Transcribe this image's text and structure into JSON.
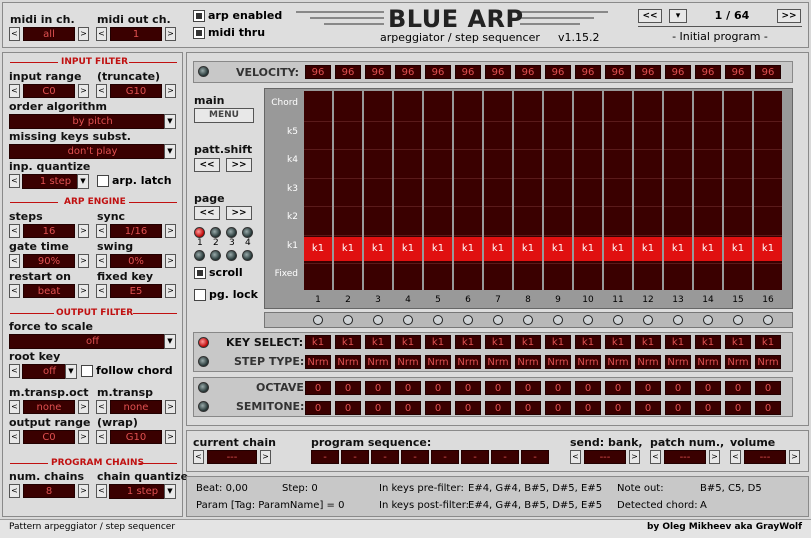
{
  "midi": {
    "in_label": "midi in ch.",
    "in_value": "all",
    "out_label": "midi out ch.",
    "out_value": "1"
  },
  "toggles": {
    "arp_enabled": "arp enabled",
    "midi_thru": "midi thru"
  },
  "title": {
    "name": "BLUE ARP",
    "subtitle": "arpeggiator / step sequencer",
    "version": "v1.15.2"
  },
  "program": {
    "counter": "1 / 64",
    "name": "- Initial program -"
  },
  "input_filter": {
    "header": "INPUT FILTER",
    "range_label": "input range",
    "truncate_label": "(truncate)",
    "range_low": "C0",
    "range_high": "G10",
    "order_label": "order algorithm",
    "order_value": "by pitch",
    "missing_label": "missing keys subst.",
    "missing_value": "don't play",
    "quantize_label": "inp. quantize",
    "quantize_value": "1 step",
    "latch_label": "arp. latch"
  },
  "arp_engine": {
    "header": "ARP ENGINE",
    "steps_label": "steps",
    "steps_value": "16",
    "sync_label": "sync",
    "sync_value": "1/16",
    "gate_label": "gate time",
    "gate_value": "90%",
    "swing_label": "swing",
    "swing_value": "0%",
    "restart_label": "restart on",
    "restart_value": "beat",
    "fixed_label": "fixed key",
    "fixed_value": "E5"
  },
  "output_filter": {
    "header": "OUTPUT FILTER",
    "scale_label": "force to scale",
    "scale_value": "off",
    "root_label": "root key",
    "root_value": "off",
    "follow_label": "follow chord",
    "transp_oct_label": "m.transp.oct",
    "transp_oct_value": "none",
    "transp_label": "m.transp",
    "transp_value": "none",
    "range_label": "output range",
    "wrap_label": "(wrap)",
    "range_low": "C0",
    "range_high": "G10"
  },
  "chains": {
    "header": "PROGRAM CHAINS",
    "num_label": "num. chains",
    "num_value": "8",
    "quantize_label": "chain quantize",
    "quantize_value": "1 step"
  },
  "velocity": {
    "label": "VELOCITY:",
    "values": [
      "96",
      "96",
      "96",
      "96",
      "96",
      "96",
      "96",
      "96",
      "96",
      "96",
      "96",
      "96",
      "96",
      "96",
      "96",
      "96"
    ]
  },
  "side": {
    "main_label": "main",
    "menu": "MENU",
    "shift_label": "patt.shift",
    "page_label": "page",
    "prev": "<<",
    "next": ">>",
    "scroll_label": "scroll",
    "lock_label": "pg. lock",
    "page_nums": [
      "1",
      "2",
      "3",
      "4"
    ]
  },
  "grid": {
    "rows": [
      "Chord",
      "k5",
      "k4",
      "k3",
      "k2",
      "k1",
      "Fixed"
    ],
    "cols": [
      "1",
      "2",
      "3",
      "4",
      "5",
      "6",
      "7",
      "8",
      "9",
      "10",
      "11",
      "12",
      "13",
      "14",
      "15",
      "16"
    ],
    "note": "k1"
  },
  "key_select": {
    "label": "KEY SELECT:",
    "values": [
      "k1",
      "k1",
      "k1",
      "k1",
      "k1",
      "k1",
      "k1",
      "k1",
      "k1",
      "k1",
      "k1",
      "k1",
      "k1",
      "k1",
      "k1",
      "k1"
    ]
  },
  "step_type": {
    "label": "STEP TYPE:",
    "values": [
      "Nrm",
      "Nrm",
      "Nrm",
      "Nrm",
      "Nrm",
      "Nrm",
      "Nrm",
      "Nrm",
      "Nrm",
      "Nrm",
      "Nrm",
      "Nrm",
      "Nrm",
      "Nrm",
      "Nrm",
      "Nrm"
    ]
  },
  "octave": {
    "label": "OCTAVE:",
    "values": [
      "0",
      "0",
      "0",
      "0",
      "0",
      "0",
      "0",
      "0",
      "0",
      "0",
      "0",
      "0",
      "0",
      "0",
      "0",
      "0"
    ]
  },
  "semitone": {
    "label": "SEMITONE:",
    "values": [
      "0",
      "0",
      "0",
      "0",
      "0",
      "0",
      "0",
      "0",
      "0",
      "0",
      "0",
      "0",
      "0",
      "0",
      "0",
      "0"
    ]
  },
  "chain_bar": {
    "current_label": "current chain",
    "current_value": "---",
    "seq_label": "program sequence:",
    "seq_values": [
      "-",
      "-",
      "-",
      "-",
      "-",
      "-",
      "-",
      "-"
    ],
    "send_label": "send: bank,",
    "send_value": "---",
    "patch_label": "patch num.,",
    "patch_value": "---",
    "vol_label": "volume",
    "vol_value": "---"
  },
  "info": {
    "beat": "Beat: 0,00",
    "step": "Step: 0",
    "pre_label": "In keys pre-filter:",
    "pre_value": "E#4, G#4, B#5, D#5, E#5",
    "note_label": "Note out:",
    "note_value": "B#5, C5, D5",
    "param": "Param [Tag: ParamName] = 0",
    "post_label": "In keys post-filter:",
    "post_value": "E#4, G#4, B#5, D#5, E#5",
    "chord_label": "Detected chord:",
    "chord_value": "A"
  },
  "footer": {
    "left": "Pattern arpeggiator / step sequencer",
    "right": "by Oleg Mikheev aka GrayWolf"
  },
  "colors": {
    "led_red": "#e01010",
    "cell_bg": "#3a0000",
    "cell_text": "#e05050"
  }
}
